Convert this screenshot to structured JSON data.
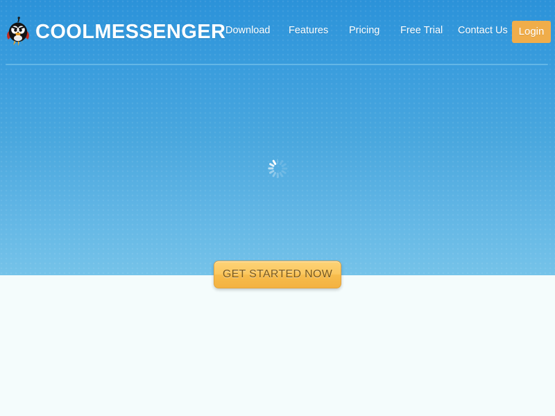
{
  "brand": {
    "name": "COOLMESSENGER",
    "icon": "angry-bird-logo-icon"
  },
  "nav": {
    "items": [
      {
        "label": "Download"
      },
      {
        "label": "Features"
      },
      {
        "label": "Pricing"
      },
      {
        "label": "Free Trial"
      },
      {
        "label": "Contact Us"
      }
    ],
    "login_label": "Login"
  },
  "hero": {
    "cta_label": "GET STARTED NOW",
    "spinner": "loading-spinner-icon"
  },
  "colors": {
    "hero_top": "#2b92d9",
    "hero_bottom": "#75c3e9",
    "accent_orange": "#f0ad4a",
    "cta_gradient_top": "#fcd377",
    "cta_gradient_bottom": "#f3b241",
    "cta_text": "#7a5a1e",
    "lower_background": "#f4fcfc",
    "divider": "#63b6e6"
  }
}
